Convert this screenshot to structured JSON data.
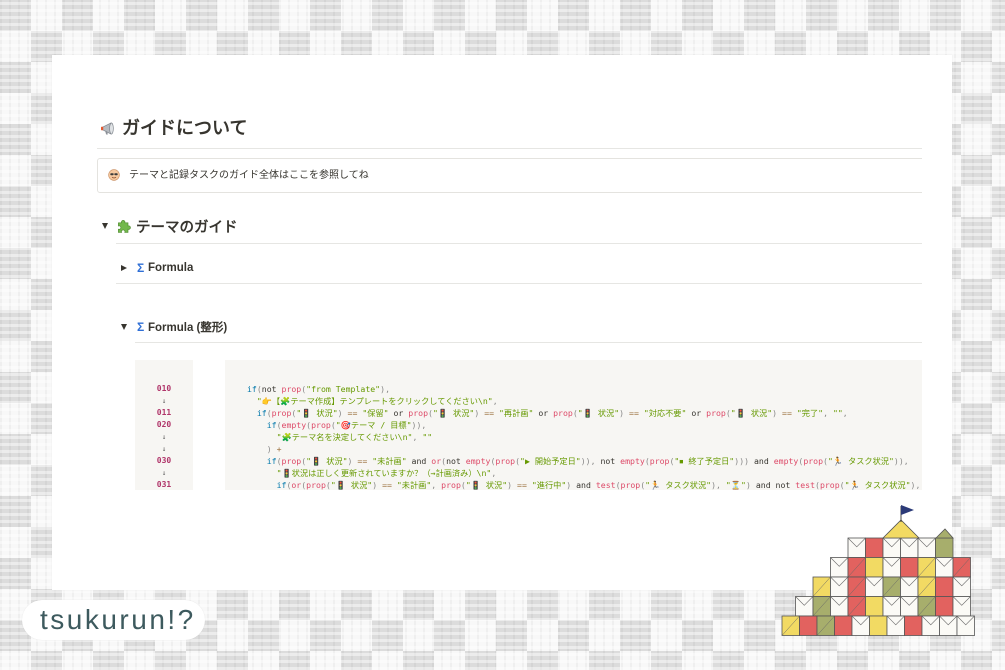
{
  "page": {
    "heading": {
      "icon": "megaphone-icon",
      "title": "ガイドについて"
    },
    "callout": {
      "icon": "smiling-face-with-sunglasses-icon",
      "text": "テーマと記録タスクのガイド全体はここを参照してね"
    },
    "theme_guide": {
      "icon": "puzzle-piece-icon",
      "title": "テーマのガイド",
      "expanded": true,
      "toggles": [
        {
          "symbol": "Σ",
          "label": "Formula",
          "expanded": false
        },
        {
          "symbol": "Σ",
          "label": "Formula (整形)",
          "expanded": true
        }
      ]
    },
    "code": {
      "line_numbers": [
        "010",
        "↓",
        "011",
        "020",
        "↓",
        "↓",
        "030",
        "↓",
        "031"
      ],
      "lines": [
        "if(not prop(\"from Template\"),",
        "  \"👉【🧩テーマ作成】テンプレートをクリックしてください\\n\",",
        "  if(prop(\"🚦 状況\") == \"保留\" or prop(\"🚦 状況\") == \"再計画\" or prop(\"🚦 状況\") == \"対応不要\" or prop(\"🚦 状況\") == \"完了\", \"\",",
        "    if(empty(prop(\"🎯テーマ / 目標\")),",
        "      \"🧩テーマ名を決定してください\\n\", \"\"",
        "    ) +",
        "    if(prop(\"🚦 状況\") == \"未計画\" and or(not empty(prop(\"▶ 開始予定日\")), not empty(prop(\"⏹ 終了予定日\"))) and empty(prop(\"🏃 タスク状況\")),",
        "      \"🚦状況は正しく更新されていますか？（→計画済み）\\n\",",
        "      if(or(prop(\"🚦 状況\") == \"未計画\", prop(\"🚦 状況\") == \"進行中\") and test(prop(\"🏃 タスク状況\"), \"⏳\") and not test(prop(\"🏃 タスク状況\"),"
      ]
    }
  },
  "brand": {
    "logo_text": "tsukurun!?",
    "illustration": "castle-illustration"
  },
  "colors": {
    "text": "#37352f",
    "sigma": "#2f6fd6",
    "code_bg": "#f7f6f3",
    "line_number": "#b0356a",
    "code_keyword": "#0077aa",
    "code_function": "#dd4a68",
    "code_string": "#669900",
    "logo_text": "#3d5a5e"
  }
}
